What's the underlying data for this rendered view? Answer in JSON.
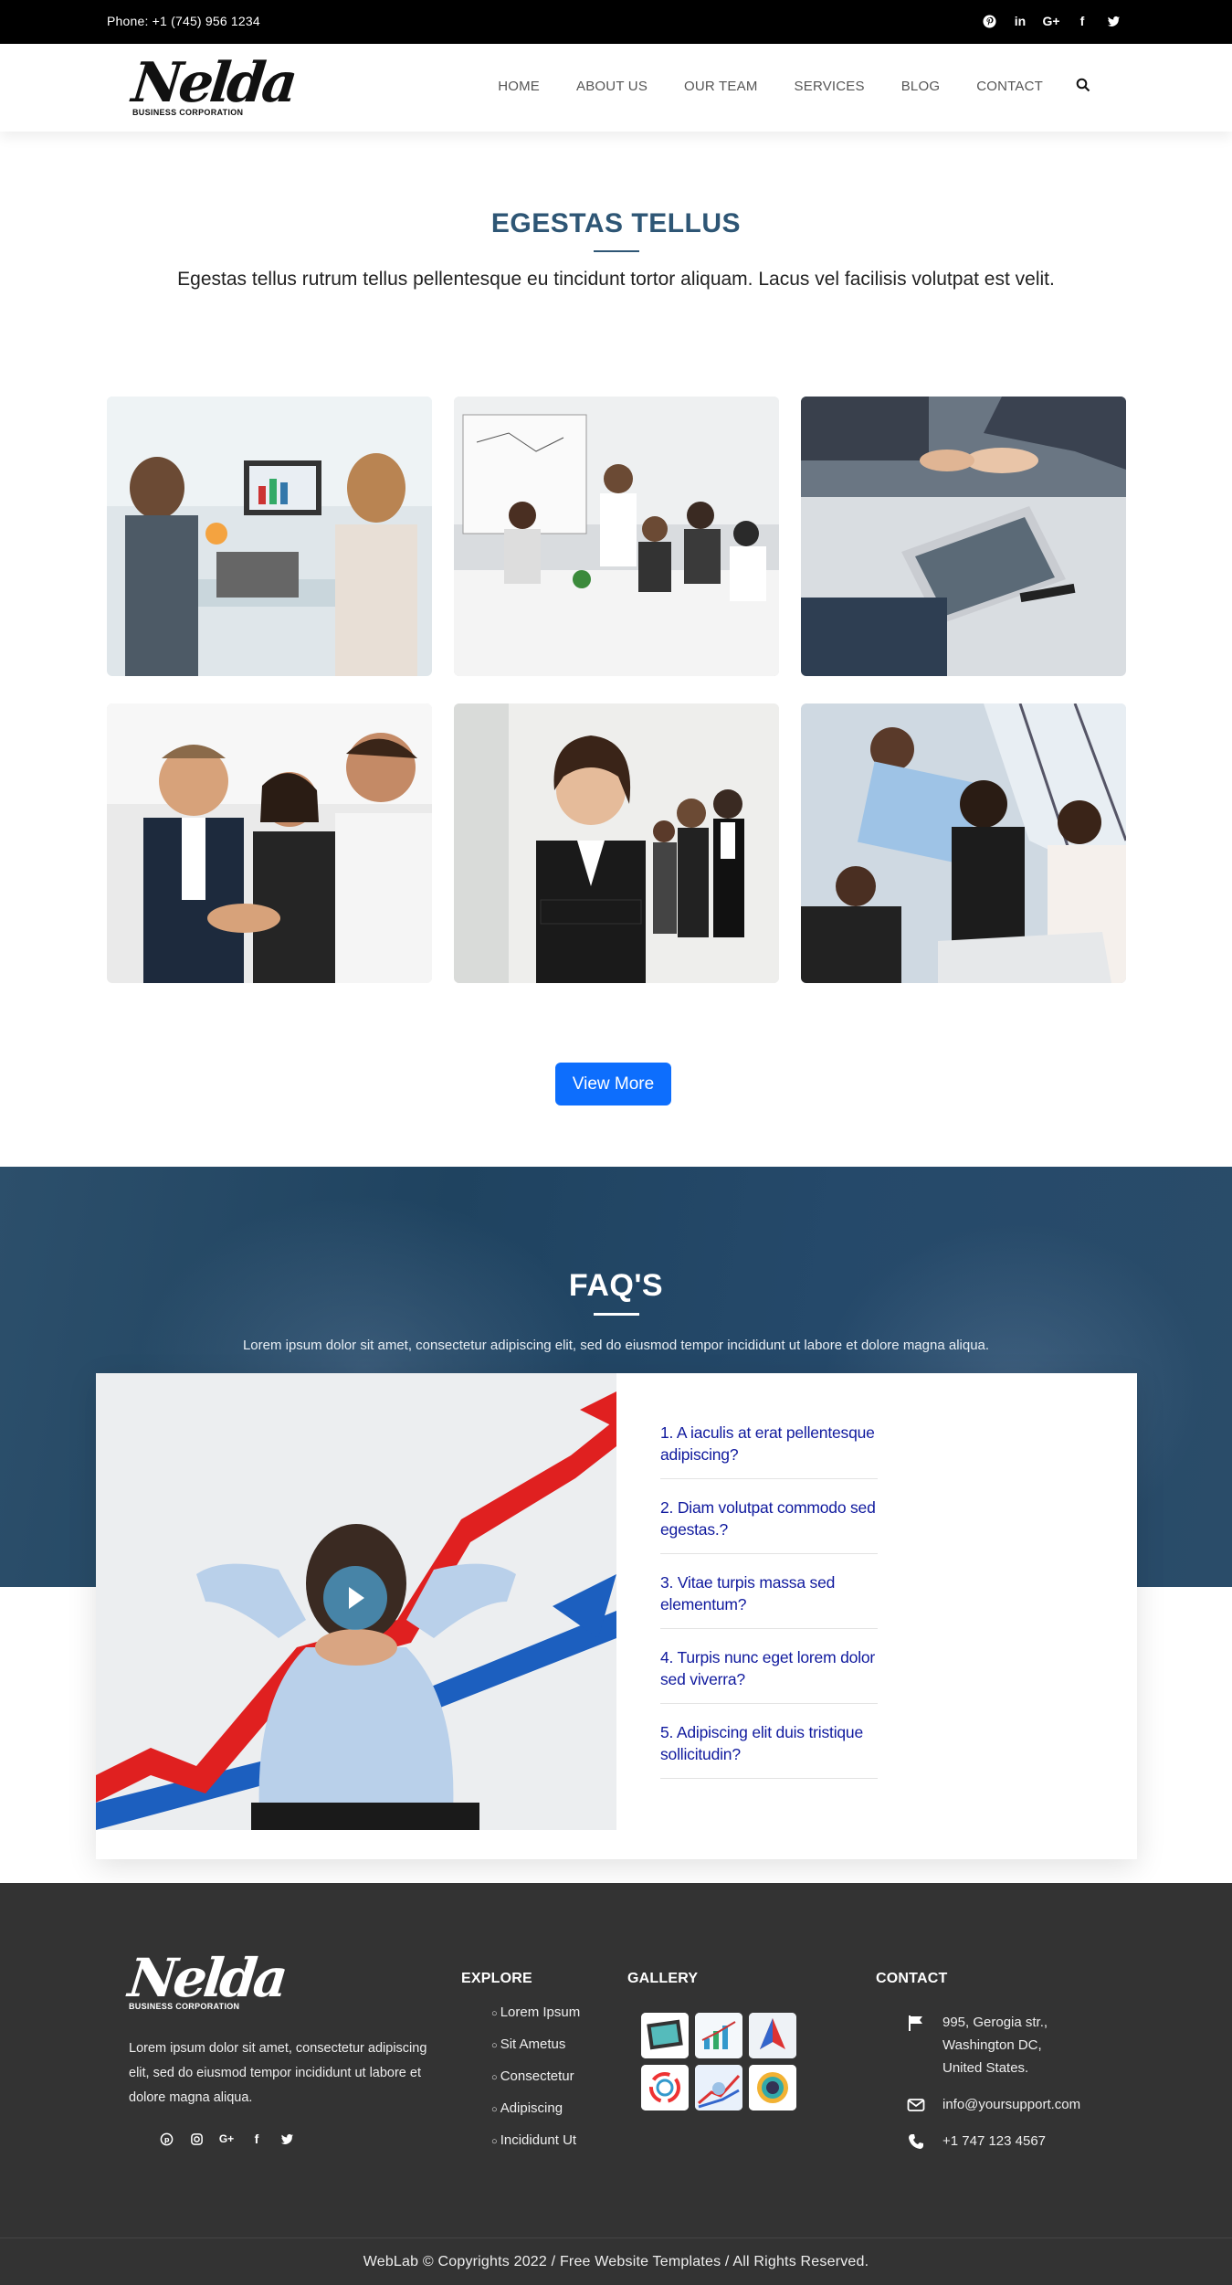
{
  "topbar": {
    "phone": "Phone: +1 (745) 956 1234",
    "social": [
      "pinterest-icon",
      "linkedin-icon",
      "google-plus-icon",
      "facebook-icon",
      "twitter-icon"
    ]
  },
  "brand": {
    "name": "Nelda",
    "tagline": "BUSINESS CORPORATION"
  },
  "nav": {
    "items": [
      "HOME",
      "ABOUT US",
      "OUR TEAM",
      "SERVICES",
      "BLOG",
      "CONTACT"
    ],
    "search_icon": "search-icon"
  },
  "intro": {
    "title": "EGESTAS TELLUS",
    "text": "Egestas tellus rutrum tellus pellentesque eu tincidunt tortor aliquam. Lacus vel facilisis volutpat est velit."
  },
  "gallery": {
    "photos": [
      "business meeting at laptop",
      "team meeting at whiteboard",
      "handshake over tablet",
      "smiling team handshake",
      "businesswoman arms crossed",
      "team around table"
    ],
    "view_more": "View More"
  },
  "faq": {
    "title": "FAQ'S",
    "subtitle": "Lorem ipsum dolor sit amet, consectetur adipiscing elit, sed do eiusmod tempor incididunt ut labore et dolore magna aliqua.",
    "questions": [
      "1. A iaculis at erat pellentesque adipiscing?",
      "2. Diam volutpat commodo sed egestas.?",
      "3. Vitae turpis massa sed elementum?",
      "4. Turpis nunc eget lorem dolor sed viverra?",
      "5. Adipiscing elit duis tristique sollicitudin?"
    ]
  },
  "footer": {
    "about": "Lorem ipsum dolor sit amet, consectetur adipiscing elit, sed do eiusmod tempor incididunt ut labore et dolore magna aliqua.",
    "explore_title": "EXPLORE",
    "explore": [
      "Lorem Ipsum",
      "Sit Ametus",
      "Consectetur",
      "Adipiscing",
      "Incididunt Ut"
    ],
    "gallery_title": "GALLERY",
    "contact_title": "CONTACT",
    "address": [
      "995, Gerogia str.,",
      "Washington DC,",
      "United States."
    ],
    "email": "info@yoursupport.com",
    "phone": "+1 747 123 4567",
    "copyright": "WebLab © Copyrights 2022 / Free Website Templates / All Rights Reserved."
  },
  "colors": {
    "accent": "#2e5675",
    "button": "#0d6efd",
    "faq_link": "#101a9e",
    "footer_bg": "#333333"
  }
}
